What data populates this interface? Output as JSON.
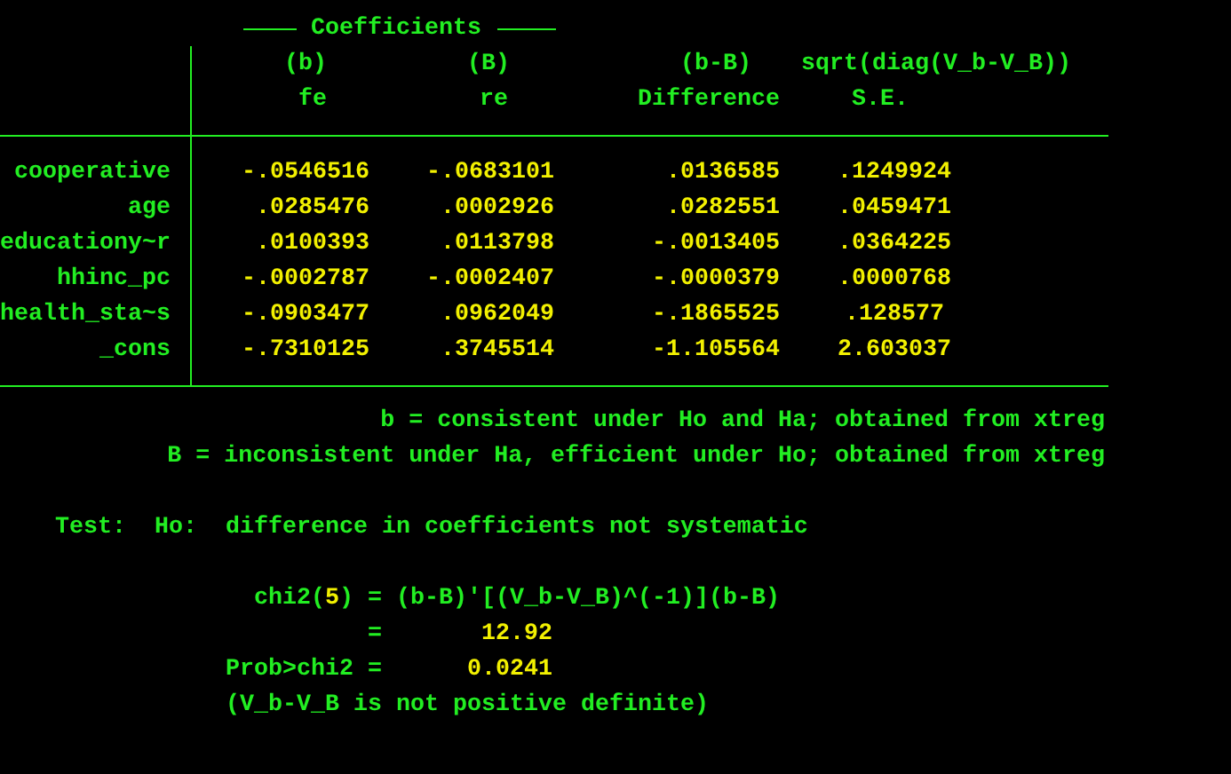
{
  "title": "Coefficients",
  "columns": [
    {
      "top": "(b)",
      "bottom": "fe"
    },
    {
      "top": "(B)",
      "bottom": "re"
    },
    {
      "top": "(b-B)",
      "bottom": "Difference"
    },
    {
      "top": "sqrt(diag(V_b-V_B))",
      "bottom": "S.E."
    }
  ],
  "rows": [
    {
      "label": "cooperative",
      "values": [
        "-.0546516",
        "-.0683101",
        ".0136585",
        ".1249924"
      ]
    },
    {
      "label": "age",
      "values": [
        ".0285476",
        ".0002926",
        ".0282551",
        ".0459471"
      ]
    },
    {
      "label": "educationy~r",
      "values": [
        ".0100393",
        ".0113798",
        "-.0013405",
        ".0364225"
      ]
    },
    {
      "label": "hhinc_pc",
      "values": [
        "-.0002787",
        "-.0002407",
        "-.0000379",
        ".0000768"
      ]
    },
    {
      "label": "health_sta~s",
      "values": [
        "-.0903477",
        ".0962049",
        "-.1865525",
        ".128577"
      ]
    },
    {
      "label": "_cons",
      "values": [
        "-.7310125",
        ".3745514",
        "-1.105564",
        "2.603037"
      ]
    }
  ],
  "notes": [
    "b = consistent under Ho and Ha; obtained from xtreg",
    "B = inconsistent under Ha, efficient under Ho; obtained from xtreg"
  ],
  "test": {
    "prefix": "Test:",
    "hypothesis_label": "Ho:",
    "hypothesis": "difference in coefficients not systematic"
  },
  "chi2": {
    "label_parts": [
      "chi2(",
      "5",
      ")"
    ],
    "equals": "=",
    "formula": "(b-B)'[(V_b-V_B)^(-1)](b-B)",
    "value_equals": "=",
    "value": "12.92"
  },
  "prob": {
    "label": "Prob>chi2 =",
    "value": "0.0241"
  },
  "warning": "(V_b-V_B is not positive definite)"
}
